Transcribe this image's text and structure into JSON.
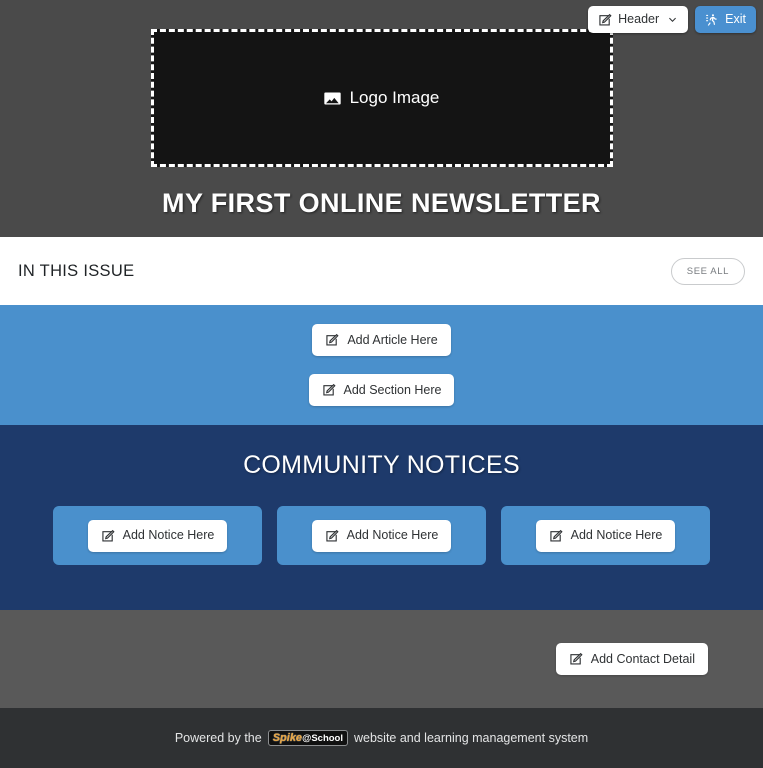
{
  "toolbar": {
    "header_button": {
      "label": "Header",
      "icon": "pencil-square-icon",
      "chevron": "chevron-down-icon"
    },
    "exit_button": {
      "label": "Exit",
      "icon": "exit-door-icon",
      "color": "#4a90d0"
    }
  },
  "masthead": {
    "background_color": "#4a4a4a",
    "logo_placeholder": {
      "label": "Logo Image",
      "icon": "image-placeholder-icon",
      "fill_color": "#141414",
      "border_style": "dashed white"
    },
    "title": "MY FIRST ONLINE NEWSLETTER"
  },
  "issue_bar": {
    "title": "IN THIS ISSUE",
    "see_all_label": "SEE ALL",
    "background_color": "#ffffff"
  },
  "articles_section": {
    "background_color": "#4a90cc",
    "buttons": [
      {
        "label": "Add Article Here",
        "icon": "pencil-square-icon"
      },
      {
        "label": "Add Section Here",
        "icon": "pencil-square-icon"
      }
    ]
  },
  "notices_section": {
    "background_color": "#1e3a6b",
    "card_color": "#4a90cc",
    "title": "COMMUNITY NOTICES",
    "cards": [
      {
        "label": "Add Notice Here",
        "icon": "pencil-square-icon"
      },
      {
        "label": "Add Notice Here",
        "icon": "pencil-square-icon"
      },
      {
        "label": "Add Notice Here",
        "icon": "pencil-square-icon"
      }
    ]
  },
  "contact_section": {
    "background_color": "#595959",
    "button": {
      "label": "Add Contact Detail",
      "icon": "pencil-square-icon"
    }
  },
  "footer": {
    "background_color": "#2f3133",
    "text_before": "Powered by the",
    "brand_primary": "Spike",
    "brand_secondary": "@School",
    "text_after": "website and learning management system"
  }
}
